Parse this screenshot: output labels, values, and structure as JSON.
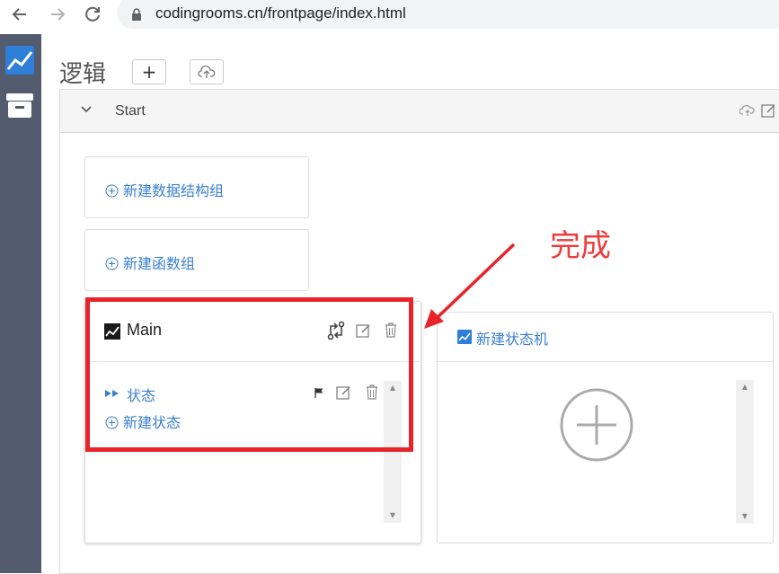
{
  "browser": {
    "url": "codingrooms.cn/frontpage/index.html"
  },
  "page": {
    "title": "逻辑"
  },
  "panel": {
    "title": "Start"
  },
  "cards": {
    "new_struct_group": "新建数据结构组",
    "new_function_group": "新建函数组",
    "main_card": {
      "title": "Main",
      "state_name": "状态",
      "new_state": "新建状态"
    },
    "new_state_machine": "新建状态机"
  },
  "annotation": {
    "text": "完成",
    "color": "#ee3b3b"
  },
  "colors": {
    "link": "#3a7fd0",
    "sidebar": "#535b6e",
    "highlight_box": "#e8232a"
  }
}
